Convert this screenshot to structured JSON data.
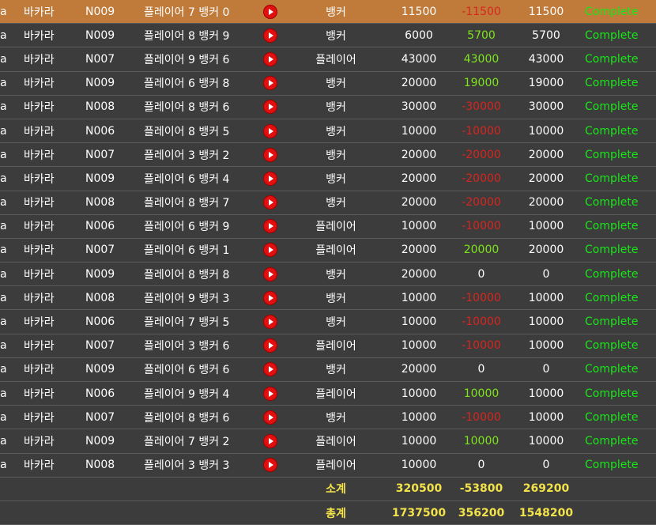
{
  "rows": [
    {
      "c0": "a",
      "game": "바카라",
      "room": "N009",
      "result": "플레이어 7 뱅커 0",
      "bet": "뱅커",
      "amount": "11500",
      "profit": "-11500",
      "profit_kind": "neg",
      "valid": "11500",
      "status": "Complete",
      "highlight": true
    },
    {
      "c0": "a",
      "game": "바카라",
      "room": "N009",
      "result": "플레이어 8 뱅커 9",
      "bet": "뱅커",
      "amount": "6000",
      "profit": "5700",
      "profit_kind": "pos",
      "valid": "5700",
      "status": "Complete",
      "highlight": false
    },
    {
      "c0": "a",
      "game": "바카라",
      "room": "N007",
      "result": "플레이어 9 뱅커 6",
      "bet": "플레이어",
      "amount": "43000",
      "profit": "43000",
      "profit_kind": "pos",
      "valid": "43000",
      "status": "Complete",
      "highlight": false
    },
    {
      "c0": "a",
      "game": "바카라",
      "room": "N009",
      "result": "플레이어 6 뱅커 8",
      "bet": "뱅커",
      "amount": "20000",
      "profit": "19000",
      "profit_kind": "pos",
      "valid": "19000",
      "status": "Complete",
      "highlight": false
    },
    {
      "c0": "a",
      "game": "바카라",
      "room": "N008",
      "result": "플레이어 8 뱅커 6",
      "bet": "뱅커",
      "amount": "30000",
      "profit": "-30000",
      "profit_kind": "neg",
      "valid": "30000",
      "status": "Complete",
      "highlight": false
    },
    {
      "c0": "a",
      "game": "바카라",
      "room": "N006",
      "result": "플레이어 8 뱅커 5",
      "bet": "뱅커",
      "amount": "10000",
      "profit": "-10000",
      "profit_kind": "neg",
      "valid": "10000",
      "status": "Complete",
      "highlight": false
    },
    {
      "c0": "a",
      "game": "바카라",
      "room": "N007",
      "result": "플레이어 3 뱅커 2",
      "bet": "뱅커",
      "amount": "20000",
      "profit": "-20000",
      "profit_kind": "neg",
      "valid": "20000",
      "status": "Complete",
      "highlight": false
    },
    {
      "c0": "a",
      "game": "바카라",
      "room": "N009",
      "result": "플레이어 6 뱅커 4",
      "bet": "뱅커",
      "amount": "20000",
      "profit": "-20000",
      "profit_kind": "neg",
      "valid": "20000",
      "status": "Complete",
      "highlight": false
    },
    {
      "c0": "a",
      "game": "바카라",
      "room": "N008",
      "result": "플레이어 8 뱅커 7",
      "bet": "뱅커",
      "amount": "20000",
      "profit": "-20000",
      "profit_kind": "neg",
      "valid": "20000",
      "status": "Complete",
      "highlight": false
    },
    {
      "c0": "a",
      "game": "바카라",
      "room": "N006",
      "result": "플레이어 6 뱅커 9",
      "bet": "플레이어",
      "amount": "10000",
      "profit": "-10000",
      "profit_kind": "neg",
      "valid": "10000",
      "status": "Complete",
      "highlight": false
    },
    {
      "c0": "a",
      "game": "바카라",
      "room": "N007",
      "result": "플레이어 6 뱅커 1",
      "bet": "플레이어",
      "amount": "20000",
      "profit": "20000",
      "profit_kind": "pos",
      "valid": "20000",
      "status": "Complete",
      "highlight": false
    },
    {
      "c0": "a",
      "game": "바카라",
      "room": "N009",
      "result": "플레이어 8 뱅커 8",
      "bet": "뱅커",
      "amount": "20000",
      "profit": "0",
      "profit_kind": "zero",
      "valid": "0",
      "status": "Complete",
      "highlight": false
    },
    {
      "c0": "a",
      "game": "바카라",
      "room": "N008",
      "result": "플레이어 9 뱅커 3",
      "bet": "뱅커",
      "amount": "10000",
      "profit": "-10000",
      "profit_kind": "neg",
      "valid": "10000",
      "status": "Complete",
      "highlight": false
    },
    {
      "c0": "a",
      "game": "바카라",
      "room": "N006",
      "result": "플레이어 7 뱅커 5",
      "bet": "뱅커",
      "amount": "10000",
      "profit": "-10000",
      "profit_kind": "neg",
      "valid": "10000",
      "status": "Complete",
      "highlight": false
    },
    {
      "c0": "a",
      "game": "바카라",
      "room": "N007",
      "result": "플레이어 3 뱅커 6",
      "bet": "플레이어",
      "amount": "10000",
      "profit": "-10000",
      "profit_kind": "neg",
      "valid": "10000",
      "status": "Complete",
      "highlight": false
    },
    {
      "c0": "a",
      "game": "바카라",
      "room": "N009",
      "result": "플레이어 6 뱅커 6",
      "bet": "뱅커",
      "amount": "20000",
      "profit": "0",
      "profit_kind": "zero",
      "valid": "0",
      "status": "Complete",
      "highlight": false
    },
    {
      "c0": "a",
      "game": "바카라",
      "room": "N006",
      "result": "플레이어 9 뱅커 4",
      "bet": "플레이어",
      "amount": "10000",
      "profit": "10000",
      "profit_kind": "pos",
      "valid": "10000",
      "status": "Complete",
      "highlight": false
    },
    {
      "c0": "a",
      "game": "바카라",
      "room": "N007",
      "result": "플레이어 8 뱅커 6",
      "bet": "뱅커",
      "amount": "10000",
      "profit": "-10000",
      "profit_kind": "neg",
      "valid": "10000",
      "status": "Complete",
      "highlight": false
    },
    {
      "c0": "a",
      "game": "바카라",
      "room": "N009",
      "result": "플레이어 7 뱅커 2",
      "bet": "플레이어",
      "amount": "10000",
      "profit": "10000",
      "profit_kind": "pos",
      "valid": "10000",
      "status": "Complete",
      "highlight": false
    },
    {
      "c0": "a",
      "game": "바카라",
      "room": "N008",
      "result": "플레이어 3 뱅커 3",
      "bet": "플레이어",
      "amount": "10000",
      "profit": "0",
      "profit_kind": "zero",
      "valid": "0",
      "status": "Complete",
      "highlight": false
    }
  ],
  "subtotal": {
    "label": "소계",
    "amount": "320500",
    "profit": "-53800",
    "valid": "269200"
  },
  "total": {
    "label": "총계",
    "amount": "1737500",
    "profit": "356200",
    "valid": "1548200"
  },
  "icons": {
    "play": "play-circle-icon"
  },
  "colors": {
    "highlight_row": "#c07a3a",
    "positive": "#7de41b",
    "negative": "#d9251f",
    "complete": "#19e619",
    "sum_text": "#f2e24a",
    "background": "#3c3c3c"
  }
}
